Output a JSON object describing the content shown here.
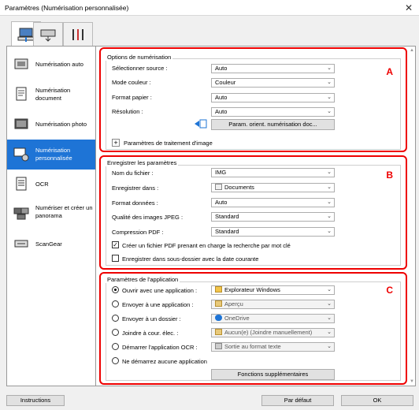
{
  "window": {
    "title": "Paramètres (Numérisation personnalisée)"
  },
  "tabs": [
    {
      "name": "scan-from-computer",
      "icon": "computer-scan-icon"
    },
    {
      "name": "scan-from-panel",
      "icon": "panel-scan-icon"
    },
    {
      "name": "general-settings",
      "icon": "tools-icon"
    }
  ],
  "sidebar": {
    "items": [
      {
        "label": "Numérisation auto",
        "icon": "auto-scan-icon"
      },
      {
        "label": "Numérisation document",
        "icon": "document-scan-icon"
      },
      {
        "label": "Numérisation photo",
        "icon": "photo-scan-icon"
      },
      {
        "label": "Numérisation personnalisée",
        "icon": "custom-scan-icon",
        "selected": true
      },
      {
        "label": "OCR",
        "icon": "ocr-icon"
      },
      {
        "label": "Numériser et créer un panorama",
        "icon": "panorama-icon"
      },
      {
        "label": "ScanGear",
        "icon": "scangear-icon"
      }
    ]
  },
  "scan_options": {
    "title": "Options de numérisation",
    "letter": "A",
    "rows": [
      {
        "label": "Sélectionner source :",
        "value": "Auto"
      },
      {
        "label": "Mode couleur :",
        "value": "Couleur"
      },
      {
        "label": "Format papier :",
        "value": "Auto"
      },
      {
        "label": "Résolution :",
        "value": "Auto"
      }
    ],
    "orient_button": "Param. orient. numérisation doc...",
    "image_processing": "Paramètres de traitement d'image",
    "expander_symbol": "+"
  },
  "save_settings": {
    "title": "Enregistrer les paramètres",
    "letter": "B",
    "rows": [
      {
        "label": "Nom du fichier :",
        "value": "IMG",
        "type": "text"
      },
      {
        "label": "Enregistrer dans :",
        "value": "Documents",
        "type": "select"
      },
      {
        "label": "Format données :",
        "value": "Auto",
        "type": "select"
      },
      {
        "label": "Qualité des images JPEG :",
        "value": "Standard",
        "type": "select"
      },
      {
        "label": "Compression PDF :",
        "value": "Standard",
        "type": "select"
      }
    ],
    "check_pdf_search": {
      "label": "Créer un fichier PDF prenant en charge la recherche par mot clé",
      "checked": true
    },
    "check_subfolder": {
      "label": "Enregistrer dans sous-dossier avec la date courante",
      "checked": false
    }
  },
  "app_settings": {
    "title": "Paramètres de l'application",
    "letter": "C",
    "options": [
      {
        "label": "Ouvrir avec une application :",
        "value": "Explorateur Windows",
        "selected": true,
        "enabled": true
      },
      {
        "label": "Envoyer à une application :",
        "value": "Aperçu",
        "selected": false,
        "enabled": false
      },
      {
        "label": "Envoyer à un dossier :",
        "value": "OneDrive",
        "selected": false,
        "enabled": false
      },
      {
        "label": "Joindre à cour. élec. :",
        "value": "Aucun(e) (Joindre manuellement)",
        "selected": false,
        "enabled": false
      },
      {
        "label": "Démarrer l'application OCR :",
        "value": "Sortie au format texte",
        "selected": false,
        "enabled": false
      },
      {
        "label": "Ne démarrez aucune application",
        "selected": false
      }
    ],
    "more_button": "Fonctions supplémentaires"
  },
  "footer": {
    "instructions": "Instructions",
    "default": "Par défaut",
    "ok": "OK"
  },
  "colors": {
    "accent": "#1e74d6",
    "highlight": "#ee0000"
  }
}
